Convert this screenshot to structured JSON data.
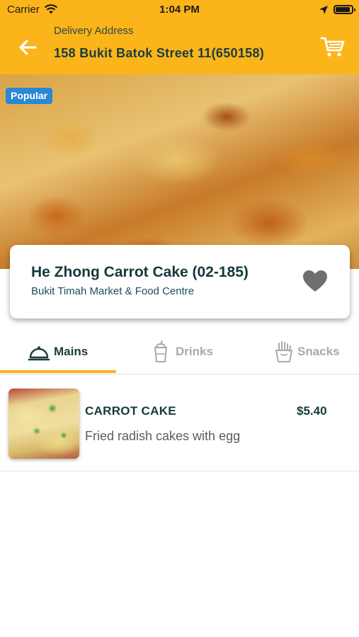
{
  "status_bar": {
    "carrier": "Carrier",
    "time": "1:04 PM"
  },
  "header": {
    "delivery_label": "Delivery Address",
    "delivery_address": "158 Bukit Batok Street 11(650158)",
    "back_icon": "arrow-left-icon",
    "cart_icon": "cart-icon",
    "background_color": "#fbb41a"
  },
  "hero": {
    "badge": "Popular",
    "badge_color": "#2a87d6"
  },
  "stall": {
    "name": "He Zhong Carrot Cake (02-185)",
    "location": "Bukit Timah Market & Food Centre",
    "favorite_icon": "heart-icon"
  },
  "tabs": [
    {
      "label": "Mains",
      "icon": "cloche-icon",
      "active": true
    },
    {
      "label": "Drinks",
      "icon": "drink-cup-icon",
      "active": false
    },
    {
      "label": "Snacks",
      "icon": "fries-icon",
      "active": false
    }
  ],
  "menu_items": [
    {
      "name": "CARROT CAKE",
      "price": "$5.40",
      "description": "Fried radish cakes with egg"
    }
  ]
}
